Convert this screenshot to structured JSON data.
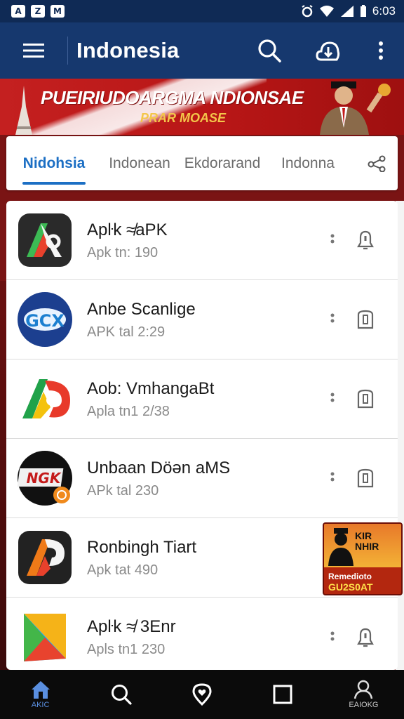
{
  "status_bar": {
    "time": "6:03",
    "left_icons": [
      "A",
      "Z",
      "M"
    ]
  },
  "app_bar": {
    "title": "Indonesia",
    "icons": [
      "menu-icon",
      "search-icon",
      "cloud-download-icon",
      "more-vert-icon"
    ]
  },
  "banner": {
    "title": "PUEIRIUDOARGMA NDIONSAE",
    "subtitle": "PRAR MOASE"
  },
  "tabs": [
    {
      "label": "Nidohsia",
      "active": true
    },
    {
      "label": "Indonean",
      "active": false
    },
    {
      "label": "Ekdorarand",
      "active": false
    },
    {
      "label": "Indonna",
      "active": false
    }
  ],
  "apps": [
    {
      "name": "Apŀk ≉aPK",
      "sub": "Apk tn: 190",
      "action_icon": "bell-icon"
    },
    {
      "name": "Anbe Scanlige",
      "sub": "APK tal 2:29",
      "action_icon": "download-icon"
    },
    {
      "name": "Aob: VmhangaBt",
      "sub": "Apla tn1 2/38",
      "action_icon": "download-icon"
    },
    {
      "name": "Unbaan Döən aMS",
      "sub": "APk tal 230",
      "action_icon": "download-icon"
    },
    {
      "name": "Ronbingh Tiart",
      "sub": "Apk tat 490",
      "action_icon": "none"
    },
    {
      "name": "Apŀk ≉ 3Enr",
      "sub": "Apls tn1 230",
      "action_icon": "bell-icon"
    }
  ],
  "promo": {
    "line1": "KIR",
    "line2": "NHIR",
    "line3": "Remedioto",
    "line4": "GU2S0AT"
  },
  "bottom_nav": [
    {
      "label": "AKIC",
      "icon": "home-icon",
      "active": true
    },
    {
      "label": "",
      "icon": "search-icon",
      "active": false
    },
    {
      "label": "",
      "icon": "location-heart-icon",
      "active": false
    },
    {
      "label": "",
      "icon": "square-icon",
      "active": false
    },
    {
      "label": "EAIOKG",
      "icon": "profile-icon",
      "active": false
    }
  ],
  "colors": {
    "app_bar": "#16386e",
    "status_bar": "#0f2a55",
    "accent": "#1c6fc4",
    "banner": "#c42020",
    "bottom_nav": "#0b0b0b"
  }
}
